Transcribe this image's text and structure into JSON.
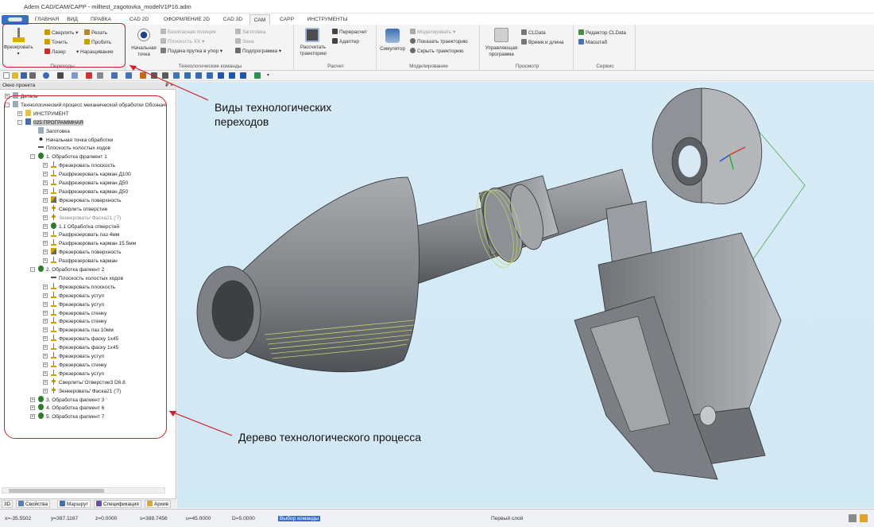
{
  "window": {
    "title": "Adem CAD/CAM/CAPP - milltest_zagotovka_modelV1P16.adm"
  },
  "menu_tabs": [
    {
      "label": "ГЛАВНАЯ"
    },
    {
      "label": "ВИД"
    },
    {
      "label": "ПРАВКА"
    },
    {
      "label": "CAD 2D"
    },
    {
      "label": "ОФОРМЛЕНИЕ 2D"
    },
    {
      "label": "CAD 3D"
    },
    {
      "label": "CAM"
    },
    {
      "label": "CAPP"
    },
    {
      "label": "ИНСТРУМЕНТЫ"
    }
  ],
  "active_tab": "CAM",
  "ribbon": {
    "transitions": {
      "big_button": "Фрезеровать",
      "items": [
        "Сверлить",
        "Резать",
        "Точить",
        "Пробить",
        "Лазер",
        "Наращивание"
      ],
      "label": "Переходы"
    },
    "tech": {
      "start_point": [
        "Начальная",
        "точка"
      ],
      "items": [
        "Безопасная позиция",
        "Плоскость XX",
        "Подача прутка в упор",
        "Заготовка",
        "Зона",
        "Подпрограмма"
      ],
      "label": "Технологические команды"
    },
    "calc": {
      "big_button": [
        "Рассчитать",
        "траекторию"
      ],
      "items": [
        "Перерасчет",
        "Адаптер"
      ],
      "label": "Расчет"
    },
    "model": {
      "big_button": "Симулятор",
      "items": [
        "Моделировать",
        "Показать траекторию",
        "Скрыть траекторию"
      ],
      "label": "Моделирование"
    },
    "view": {
      "big_button": [
        "Управляющая",
        "программа"
      ],
      "items": [
        "CLData",
        "Время и длина"
      ],
      "label": "Просмотр"
    },
    "service": {
      "items": [
        "Редактор CLData",
        "Масштаб"
      ],
      "label": "Сервис"
    }
  },
  "panel": {
    "title": "Окно проекта",
    "pin": "₽ ×"
  },
  "tree": [
    {
      "text": "Деталь",
      "level": 0,
      "icon": "doc",
      "exp": "+"
    },
    {
      "text": "Технологический процесс механической обработки Обозначение",
      "level": 0,
      "icon": "doc",
      "exp": "-"
    },
    {
      "text": "ИНСТРУМЕНТ",
      "level": 1,
      "icon": "folder",
      "exp": "+"
    },
    {
      "text": "025  ПРОГРАММНАЯ",
      "level": 1,
      "icon": "prog",
      "exp": "-",
      "selected": true
    },
    {
      "text": "Заготовка",
      "level": 2,
      "icon": "doc"
    },
    {
      "text": "Начальная точка обработки",
      "level": 2,
      "icon": "pt"
    },
    {
      "text": "Плоскость холостых ходов",
      "level": 2,
      "icon": "pl"
    },
    {
      "text": "1.  Обработка фрагмент 1",
      "level": 2,
      "icon": "gear",
      "exp": "-"
    },
    {
      "text": "Фрезеровать плоскость",
      "level": 3,
      "icon": "tool",
      "exp": "+"
    },
    {
      "text": "Разфрезеровать карман Д100",
      "level": 3,
      "icon": "tool",
      "exp": "+"
    },
    {
      "text": "Разфрезеровать карман Д50",
      "level": 3,
      "icon": "tool",
      "exp": "+"
    },
    {
      "text": "Разфрезеровать карман Д50",
      "level": 3,
      "icon": "tool",
      "exp": "+"
    },
    {
      "text": "Фрезеровать поверхность",
      "level": 3,
      "icon": "face",
      "exp": "+"
    },
    {
      "text": "Сверлить отверстие",
      "level": 3,
      "icon": "drill",
      "exp": "+"
    },
    {
      "text": "Зенкеровать/ Фаска21 ('7)",
      "level": 3,
      "icon": "drill",
      "exp": "+",
      "dim": true
    },
    {
      "text": "1.1  Обработка отверстий",
      "level": 3,
      "icon": "gear",
      "exp": "+"
    },
    {
      "text": "Разфрезеровать паз 4мм",
      "level": 3,
      "icon": "tool",
      "exp": "+"
    },
    {
      "text": "Разфрезеровать карман 15.5мм",
      "level": 3,
      "icon": "tool",
      "exp": "+"
    },
    {
      "text": "Фрезеровать поверхность",
      "level": 3,
      "icon": "face",
      "exp": "+"
    },
    {
      "text": "Разфрезеровать карман",
      "level": 3,
      "icon": "tool",
      "exp": "+"
    },
    {
      "text": "2.  Обработка фагмент 2",
      "level": 2,
      "icon": "gear",
      "exp": "-"
    },
    {
      "text": "Плоскость холостых ходов",
      "level": 3,
      "icon": "pl"
    },
    {
      "text": "Фрезеровать плоскость",
      "level": 3,
      "icon": "tool",
      "exp": "+"
    },
    {
      "text": "Фрезеровать уступ",
      "level": 3,
      "icon": "tool",
      "exp": "+"
    },
    {
      "text": "Фрезеровать уступ",
      "level": 3,
      "icon": "tool",
      "exp": "+"
    },
    {
      "text": "Фрезеровать стенку",
      "level": 3,
      "icon": "tool",
      "exp": "+"
    },
    {
      "text": "Фрезеровать стенку",
      "level": 3,
      "icon": "tool",
      "exp": "+"
    },
    {
      "text": "Фрезеровать паз 10мм",
      "level": 3,
      "icon": "tool",
      "exp": "+"
    },
    {
      "text": "Фрезеровать фаску 1x45",
      "level": 3,
      "icon": "tool",
      "exp": "+"
    },
    {
      "text": "Фрезеровать фаску 1x45",
      "level": 3,
      "icon": "tool",
      "exp": "+"
    },
    {
      "text": "Фрезеровать уступ",
      "level": 3,
      "icon": "tool",
      "exp": "+"
    },
    {
      "text": "Фрезеровать стенку",
      "level": 3,
      "icon": "tool",
      "exp": "+"
    },
    {
      "text": "Фрезеровать уступ",
      "level": 3,
      "icon": "tool",
      "exp": "+"
    },
    {
      "text": "Сверлить/ Отверстие3 D6.8",
      "level": 3,
      "icon": "drill",
      "exp": "+"
    },
    {
      "text": "Зенкеровать/ Фаска21 ('7)",
      "level": 3,
      "icon": "drill",
      "exp": "+"
    },
    {
      "text": "3.  Обработка фагмент 3",
      "level": 2,
      "icon": "gear",
      "exp": "+"
    },
    {
      "text": "4.  Обработка фагмент 6",
      "level": 2,
      "icon": "gear",
      "exp": "+"
    },
    {
      "text": "5.  Обработка фагмент 7",
      "level": 2,
      "icon": "gear",
      "exp": "+"
    }
  ],
  "panel_tabs": [
    {
      "label": "3D"
    },
    {
      "label": "Свойства"
    },
    {
      "label": "Маршрут"
    },
    {
      "label": "Спецификация"
    },
    {
      "label": "Архив"
    }
  ],
  "status": {
    "x": "x=-35.5502",
    "y": "y=387.1167",
    "z": "z=0.0000",
    "s": "s=388.7456",
    "u": "u=45.0000",
    "d": "D=5.0000",
    "cmd": "Выбор команды",
    "layer": "Первый слой"
  },
  "annotations": {
    "callout_1": [
      "Виды технологических",
      "переходов"
    ],
    "callout_2": "Дерево технологического процесса"
  },
  "colors": {
    "annotation": "#cc1f2a",
    "viewport_bg": "#d3e9f5",
    "toolpath": "#c8d36a",
    "model": "#8c8f93"
  }
}
